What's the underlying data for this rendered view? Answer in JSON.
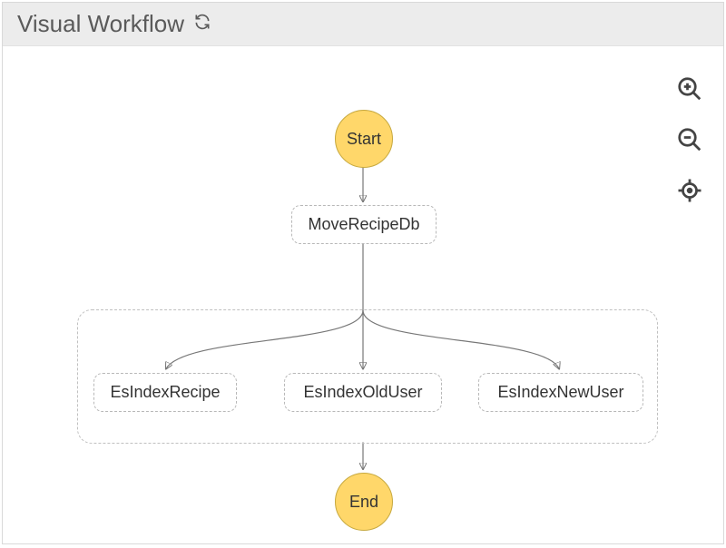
{
  "header": {
    "title": "Visual Workflow"
  },
  "controls": {
    "zoom_in": "zoom-in",
    "zoom_out": "zoom-out",
    "center": "center"
  },
  "nodes": {
    "start": {
      "label": "Start"
    },
    "move_recipe_db": {
      "label": "MoveRecipeDb"
    },
    "es_index_recipe": {
      "label": "EsIndexRecipe"
    },
    "es_index_old_user": {
      "label": "EsIndexOldUser"
    },
    "es_index_new_user": {
      "label": "EsIndexNewUser"
    },
    "end": {
      "label": "End"
    }
  },
  "edges": [
    {
      "from": "start",
      "to": "move_recipe_db"
    },
    {
      "from": "move_recipe_db",
      "to": "parallel_group"
    },
    {
      "from": "parallel_group",
      "to": "es_index_recipe"
    },
    {
      "from": "parallel_group",
      "to": "es_index_old_user"
    },
    {
      "from": "parallel_group",
      "to": "es_index_new_user"
    },
    {
      "from": "parallel_group",
      "to": "end"
    }
  ],
  "colors": {
    "node_fill": "#ffd76a",
    "node_stroke": "#c7a93f",
    "box_stroke": "#b8b8b8",
    "edge_stroke": "#777777"
  }
}
